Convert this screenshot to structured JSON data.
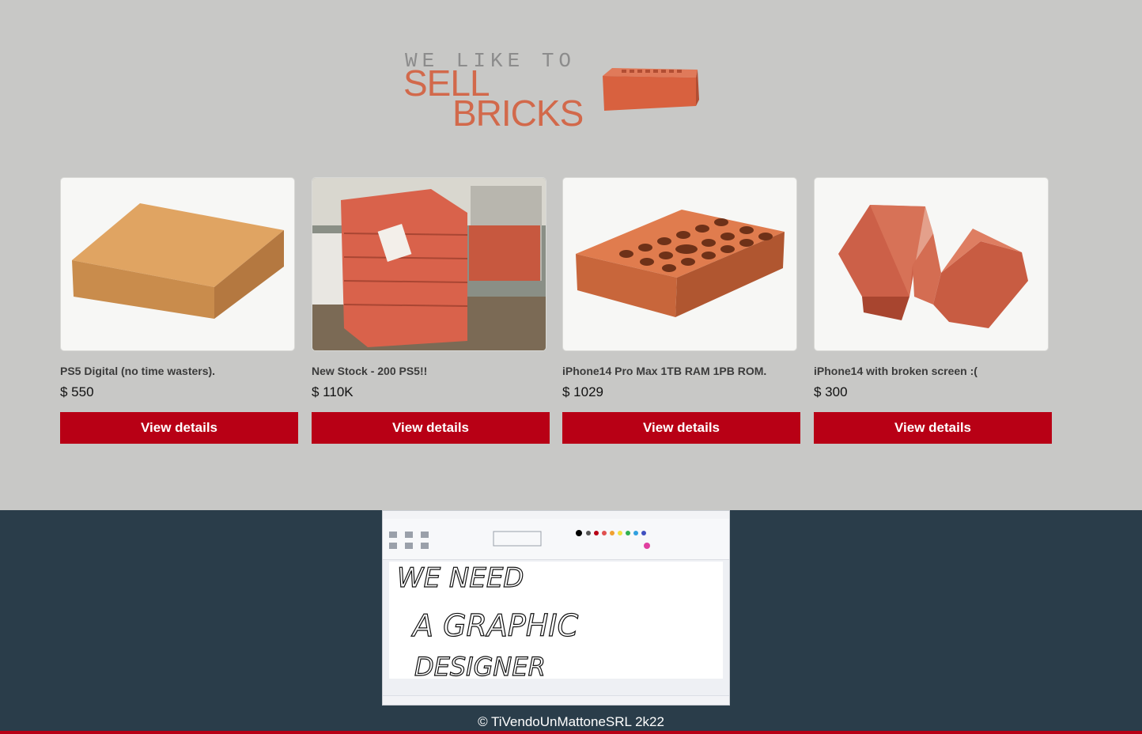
{
  "header": {
    "tagline": "WE LIKE TO",
    "logo_line1": "SELL",
    "logo_line2": "BRICKS"
  },
  "products": [
    {
      "title": "PS5 Digital (no time wasters).",
      "price": "$ 550",
      "button_label": "View details",
      "image_icon": "brick-icon"
    },
    {
      "title": "New Stock - 200 PS5!!",
      "price": "$ 110K",
      "button_label": "View details",
      "image_icon": "brick-pallet-icon"
    },
    {
      "title": "iPhone14 Pro Max 1TB RAM 1PB ROM.",
      "price": "$ 1029",
      "button_label": "View details",
      "image_icon": "hollow-brick-icon"
    },
    {
      "title": "iPhone14 with broken screen :(",
      "price": "$ 300",
      "button_label": "View details",
      "image_icon": "broken-brick-icon"
    }
  ],
  "footer": {
    "paint_canvas_text": [
      "WE NEED",
      "A GRAPHIC",
      "DESIGNER"
    ],
    "copyright": "© TiVendoUnMattoneSRL 2k22"
  },
  "colors": {
    "background": "#c8c8c6",
    "brand_orange": "#d2694b",
    "button_red": "#b80015",
    "footer_bg": "#2a3d4a"
  }
}
